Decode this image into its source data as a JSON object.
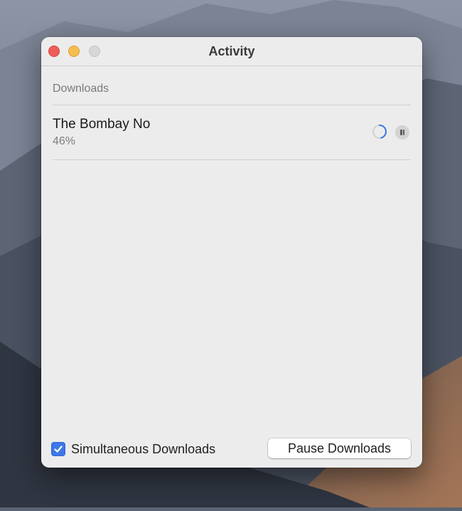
{
  "window": {
    "title": "Activity"
  },
  "downloads": {
    "section_label": "Downloads",
    "items": [
      {
        "name": "The Bombay No",
        "progress_text": "46%",
        "progress": 0.46,
        "status_icon": "spinner-icon",
        "action_icon": "pause-icon"
      }
    ]
  },
  "footer": {
    "simultaneous_label": "Simultaneous Downloads",
    "simultaneous_checked": true,
    "pause_all_label": "Pause Downloads"
  },
  "colors": {
    "accent": "#3c78e8",
    "close": "#ee5e57",
    "minimize": "#f5be4f",
    "zoom_disabled": "#d7d7d7"
  }
}
